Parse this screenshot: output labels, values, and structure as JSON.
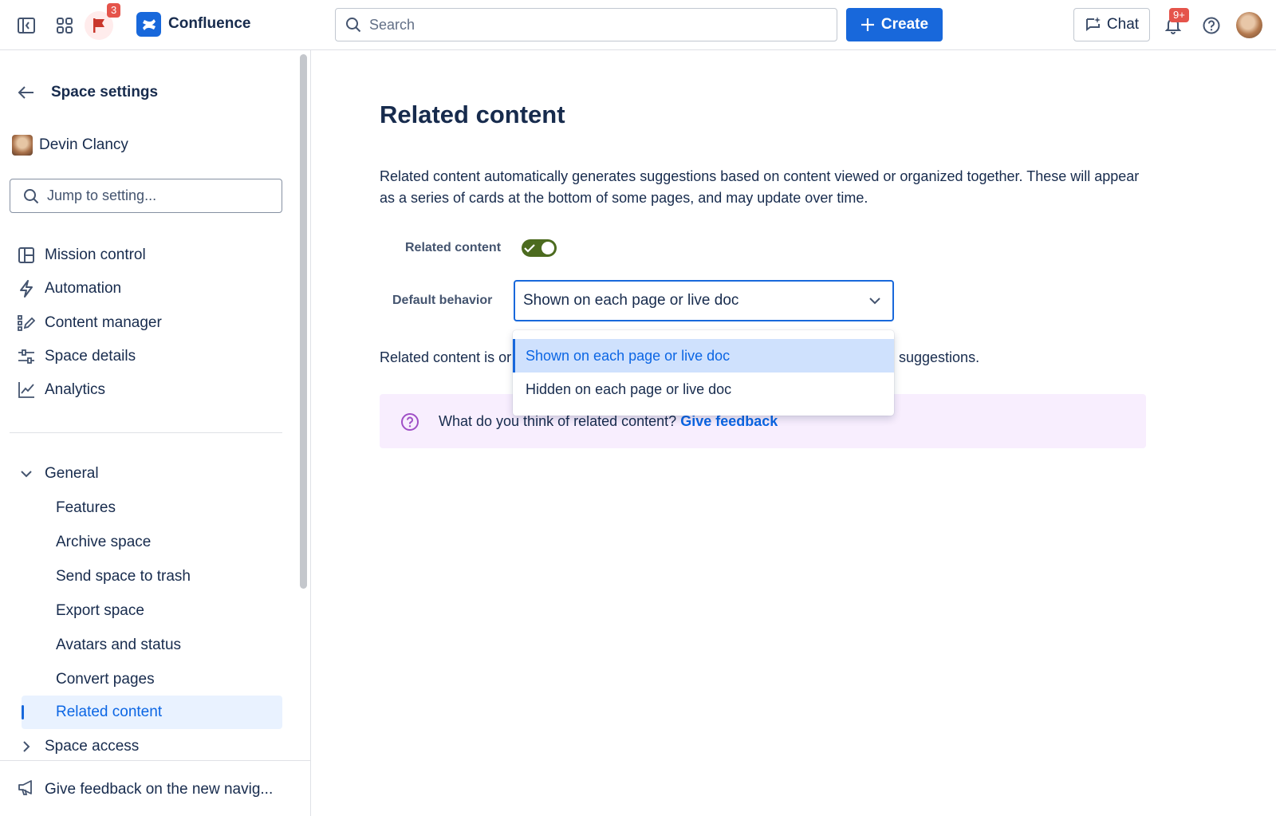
{
  "app": {
    "title": "Confluence",
    "flag_badge": "3",
    "notification_badge": "9+",
    "brand_color": "#1868db"
  },
  "topbar": {
    "search_placeholder": "Search",
    "create_label": "Create",
    "chat_label": "Chat"
  },
  "sidebar": {
    "back_title": "Space settings",
    "space_name": "Devin Clancy",
    "jump_placeholder": "Jump to setting...",
    "main_items": [
      {
        "label": "Mission control",
        "icon": "layout-icon"
      },
      {
        "label": "Automation",
        "icon": "lightning-icon"
      },
      {
        "label": "Content manager",
        "icon": "content-manager-icon"
      },
      {
        "label": "Space details",
        "icon": "sliders-icon"
      },
      {
        "label": "Analytics",
        "icon": "chart-line-icon"
      }
    ],
    "general_label": "General",
    "general_items": [
      "Features",
      "Archive space",
      "Send space to trash",
      "Export space",
      "Avatars and status",
      "Convert pages",
      "Related content"
    ],
    "active_item": "Related content",
    "space_access_label": "Space access",
    "footer_label": "Give feedback on the new navig..."
  },
  "main": {
    "title": "Related content",
    "description": "Related content automatically generates suggestions based on content viewed or organized together. These will appear as a series of cards at the bottom of some pages, and may update over time.",
    "toggle_label": "Related content",
    "toggle_on": true,
    "default_behavior_label": "Default behavior",
    "select_value": "Shown on each page or live doc",
    "dropdown_options": [
      "Shown on each page or live doc",
      "Hidden on each page or live doc"
    ],
    "partial_text_left": "Related content is or",
    "partial_text_right": "suggestions.",
    "feedback_question": "What do you think of related content?",
    "feedback_link": "Give feedback"
  }
}
